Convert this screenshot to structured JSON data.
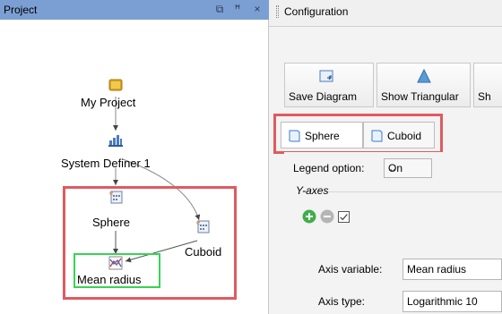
{
  "project_panel": {
    "title": "Project",
    "header_buttons": [
      "restore-icon",
      "pin-icon",
      "close-icon"
    ],
    "nodes": {
      "my_project": "My Project",
      "system_definer": "System Definer 1",
      "sphere": "Sphere",
      "cuboid": "Cuboid",
      "mean_radius": "Mean radius"
    }
  },
  "config_panel": {
    "title": "Configuration",
    "toolbar": {
      "save_diagram": "Save Diagram",
      "show_triangular": "Show Triangular",
      "cut_label": "Sh"
    },
    "tabs": [
      "Sphere",
      "Cuboid"
    ],
    "legend": {
      "label": "Legend option:",
      "value": "On"
    },
    "y_axes": {
      "title": "Y-axes",
      "axis_variable_label": "Axis variable:",
      "axis_variable_value": "Mean radius",
      "axis_type_label": "Axis type:",
      "axis_type_value": "Logarithmic 10"
    }
  },
  "colors": {
    "header_blue": "#7b9fd3",
    "highlight_red": "#e05a5f",
    "highlight_green": "#39d353"
  }
}
